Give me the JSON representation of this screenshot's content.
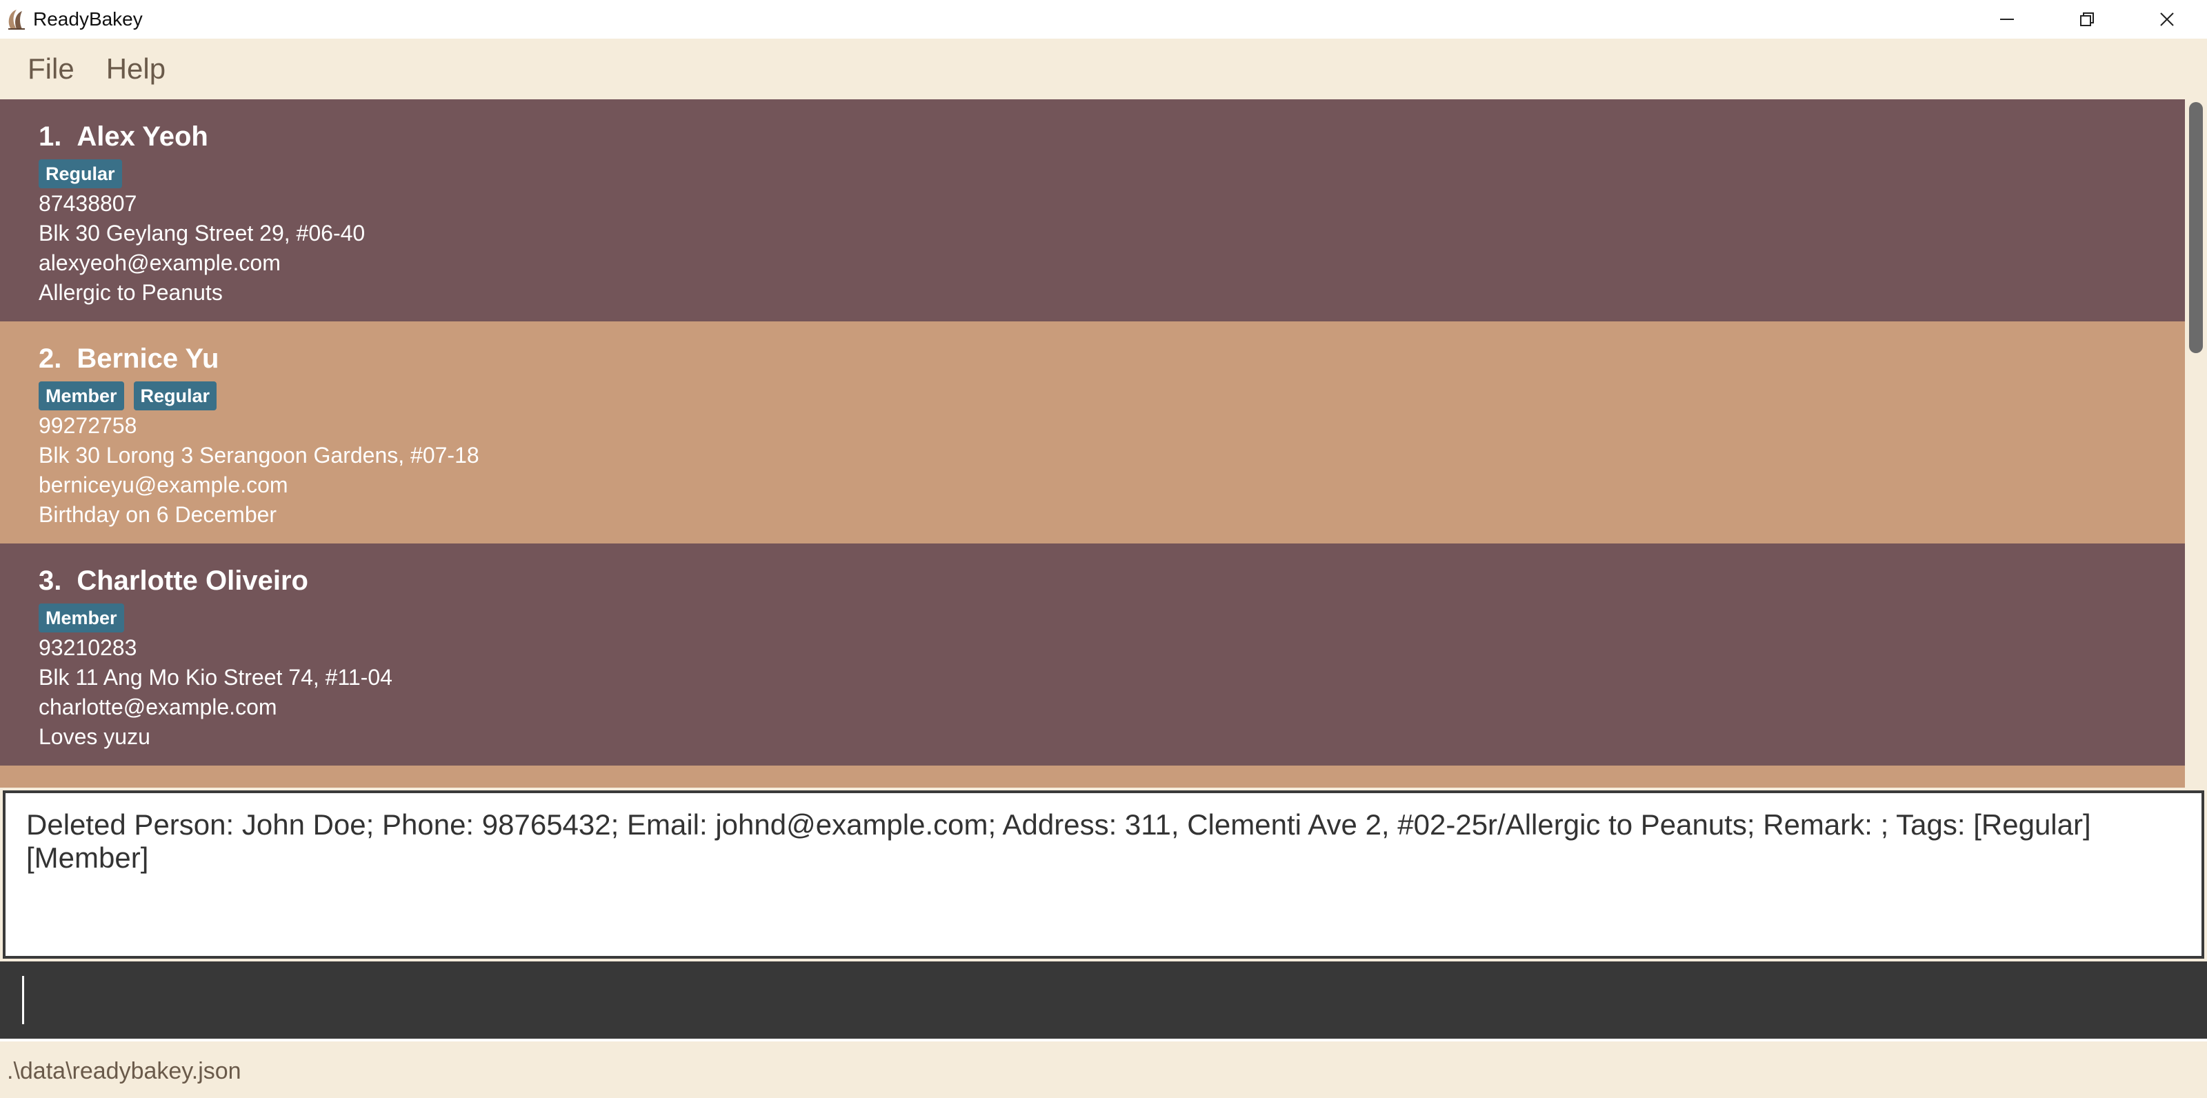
{
  "window": {
    "title": "ReadyBakey",
    "controls": [
      "minimize-icon",
      "restore-icon",
      "close-icon"
    ]
  },
  "menu": {
    "file": "File",
    "help": "Help"
  },
  "persons": [
    {
      "index": "1.",
      "name": "Alex Yeoh",
      "tags": [
        "Regular"
      ],
      "phone": "87438807",
      "address": "Blk 30 Geylang Street 29, #06-40",
      "email": "alexyeoh@example.com",
      "remark": "Allergic to Peanuts"
    },
    {
      "index": "2.",
      "name": "Bernice Yu",
      "tags": [
        "Member",
        "Regular"
      ],
      "phone": "99272758",
      "address": "Blk 30 Lorong 3 Serangoon Gardens, #07-18",
      "email": "berniceyu@example.com",
      "remark": "Birthday on 6 December"
    },
    {
      "index": "3.",
      "name": "Charlotte Oliveiro",
      "tags": [
        "Member"
      ],
      "phone": "93210283",
      "address": "Blk 11 Ang Mo Kio Street 74, #11-04",
      "email": "charlotte@example.com",
      "remark": "Loves yuzu"
    }
  ],
  "result": {
    "text": "Deleted Person: John Doe; Phone: 98765432; Email: johnd@example.com; Address: 311, Clementi Ave 2, #02-25r/Allergic to Peanuts; Remark: ; Tags: [Regular][Member]"
  },
  "command": {
    "value": ""
  },
  "status": {
    "file_path": ".\\data\\readybakey.json"
  },
  "colors": {
    "card_odd": "#735559",
    "card_even": "#c99c7b",
    "tag": "#3a7088",
    "background": "#f5ecdb",
    "command_box": "#383838"
  }
}
